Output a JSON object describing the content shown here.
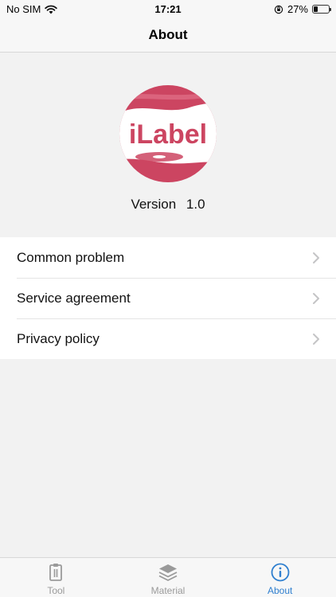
{
  "status_bar": {
    "carrier": "No SIM",
    "time": "17:21",
    "battery_percent": "27%",
    "battery_level": 0.27
  },
  "header": {
    "title": "About"
  },
  "logo": {
    "text": "iLabel",
    "brand_color": "#cc4561"
  },
  "version": {
    "label": "Version",
    "number": "1.0"
  },
  "menu": {
    "items": [
      {
        "label": "Common problem"
      },
      {
        "label": "Service agreement"
      },
      {
        "label": "Privacy policy"
      }
    ]
  },
  "tab_bar": {
    "tabs": [
      {
        "label": "Tool",
        "icon": "clipboard-icon",
        "active": false
      },
      {
        "label": "Material",
        "icon": "layers-icon",
        "active": false
      },
      {
        "label": "About",
        "icon": "info-icon",
        "active": true
      }
    ],
    "active_color": "#2f7fcf",
    "inactive_color": "#9a9a9a"
  }
}
